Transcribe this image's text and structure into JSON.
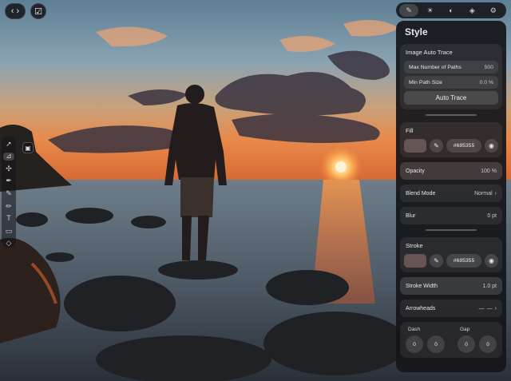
{
  "topbar": {
    "tabs": [
      {
        "icon": "pen-tool-icon",
        "glyph": "✎",
        "active": true
      },
      {
        "icon": "brightness-icon",
        "glyph": "☀",
        "active": false
      },
      {
        "icon": "color-wheel-icon",
        "glyph": "◐",
        "active": false
      },
      {
        "icon": "layers-icon",
        "glyph": "◈",
        "active": false
      },
      {
        "icon": "settings-icon",
        "glyph": "⚙",
        "active": false
      }
    ]
  },
  "nav": {
    "back_forward_icon": "back-forward-icon",
    "done_icon": "checkmark-icon"
  },
  "toolbar": {
    "tools": [
      {
        "name": "select-tool-icon",
        "glyph": "➚"
      },
      {
        "name": "direct-select-tool-icon",
        "glyph": "⊿",
        "active": true
      },
      {
        "name": "node-tool-icon",
        "glyph": "✣"
      },
      {
        "name": "pen-tool-icon",
        "glyph": "✒"
      },
      {
        "name": "brush-tool-icon",
        "glyph": "✎"
      },
      {
        "name": "pencil-tool-icon",
        "glyph": "✏"
      },
      {
        "name": "text-tool-icon",
        "glyph": "T"
      },
      {
        "name": "rectangle-tool-icon",
        "glyph": "▭"
      },
      {
        "name": "eraser-tool-icon",
        "glyph": "◇"
      }
    ]
  },
  "panel": {
    "title": "Style",
    "auto_trace": {
      "title": "Image Auto Trace",
      "max_paths_label": "Max Number of Paths",
      "max_paths_value": "500",
      "min_size_label": "Min Path Size",
      "min_size_value": "0.0 %",
      "button_label": "Auto Trace"
    },
    "fill": {
      "title": "Fill",
      "color": "#685355",
      "hex_label": "#685355"
    },
    "opacity": {
      "label": "Opacity",
      "value": "100 %"
    },
    "blend_mode": {
      "label": "Blend Mode",
      "value": "Normal"
    },
    "blur": {
      "label": "Blur",
      "value": "0 pt"
    },
    "stroke": {
      "title": "Stroke",
      "color": "#685355",
      "hex_label": "#685355"
    },
    "stroke_width": {
      "label": "Stroke Width",
      "value": "1.0 pt"
    },
    "arrowheads": {
      "label": "Arrowheads"
    },
    "dash": {
      "dash_label": "Dash",
      "gap_label": "Gap",
      "dash_values": [
        "0",
        "0"
      ],
      "gap_values": [
        "0",
        "0"
      ]
    }
  },
  "colors": {
    "accent_swatch": "#685355",
    "panel_bg": "#16161a"
  }
}
